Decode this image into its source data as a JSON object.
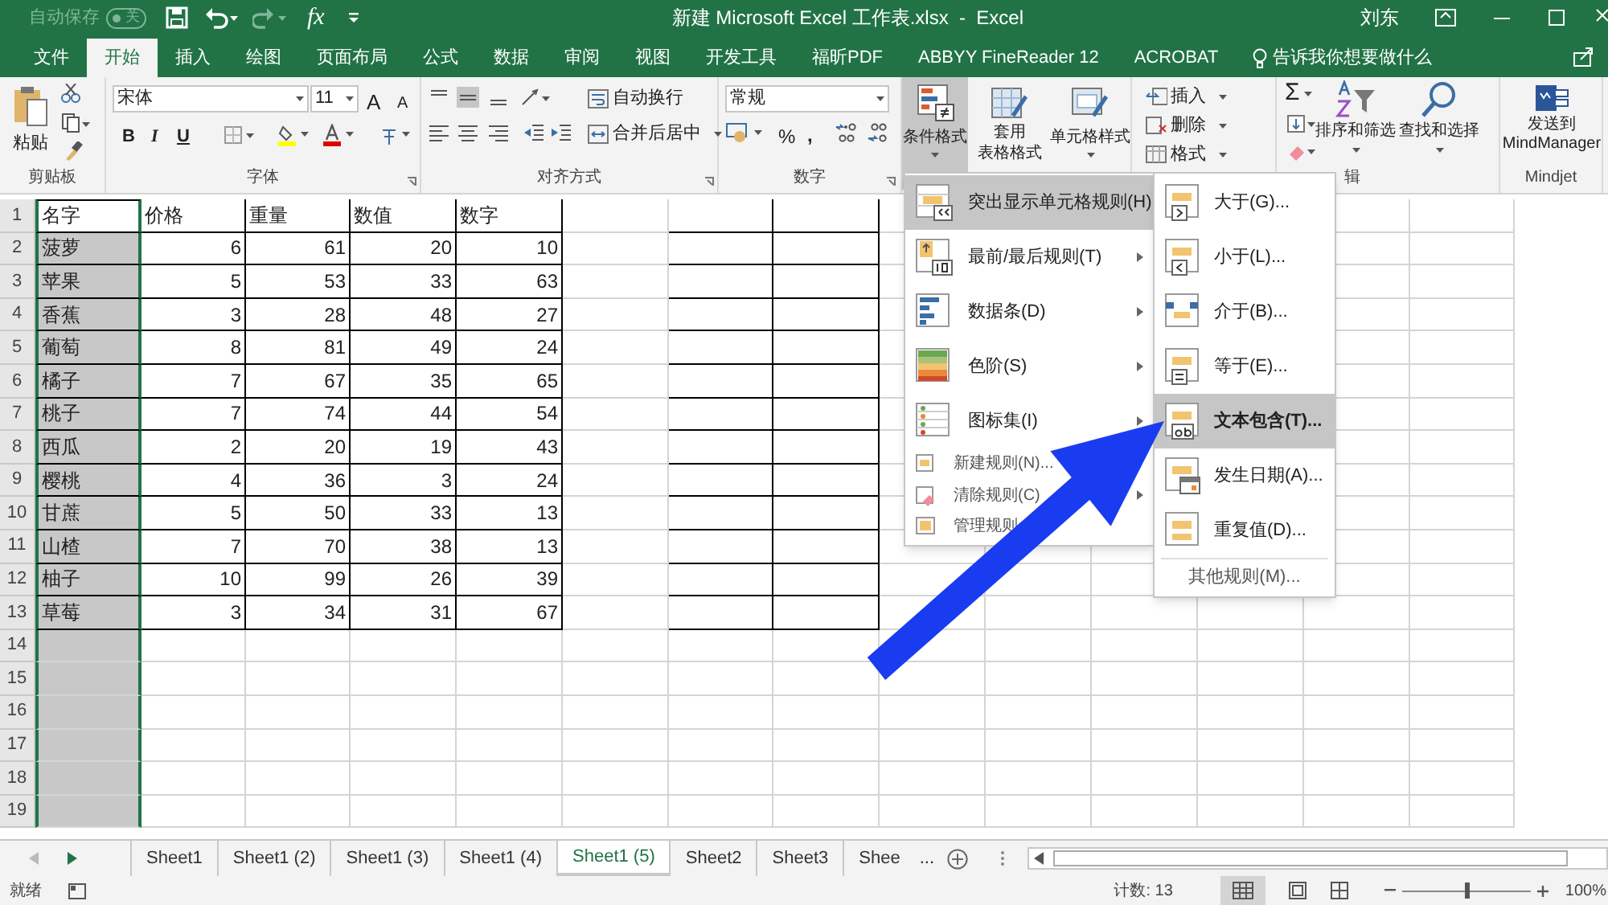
{
  "title_bar": {
    "autosave_label": "自动保存",
    "autosave_toggle": "关",
    "formula_glyph": "fx",
    "title": "新建 Microsoft Excel 工作表.xlsx  -  Excel",
    "user": "刘东"
  },
  "tabs": [
    {
      "label": "文件",
      "selected": false
    },
    {
      "label": "开始",
      "selected": true
    },
    {
      "label": "插入",
      "selected": false
    },
    {
      "label": "绘图",
      "selected": false
    },
    {
      "label": "页面布局",
      "selected": false
    },
    {
      "label": "公式",
      "selected": false
    },
    {
      "label": "数据",
      "selected": false
    },
    {
      "label": "审阅",
      "selected": false
    },
    {
      "label": "视图",
      "selected": false
    },
    {
      "label": "开发工具",
      "selected": false
    },
    {
      "label": "福昕PDF",
      "selected": false
    },
    {
      "label": "ABBYY FineReader 12",
      "selected": false
    },
    {
      "label": "ACROBAT",
      "selected": false
    }
  ],
  "tell_me": "告诉我你想要做什么",
  "ribbon": {
    "clipboard": {
      "paste": "粘贴",
      "label": "剪贴板"
    },
    "font": {
      "font_name": "宋体",
      "font_size": "11",
      "grow": "A",
      "shrink": "A",
      "bold": "B",
      "italic": "I",
      "underline": "U",
      "label": "字体"
    },
    "alignment": {
      "wrap": "自动换行",
      "merge": "合并后居中",
      "label": "对齐方式"
    },
    "number": {
      "format": "常规",
      "percent": "%",
      "comma": ",",
      "label": "数字"
    },
    "styles": {
      "conditional": "条件格式",
      "table_format": "套用",
      "table_format_2": "表格格式",
      "cell_styles": "单元格样式"
    },
    "cells": {
      "insert": "插入",
      "delete": "删除",
      "format": "格式"
    },
    "editing": {
      "sum": "Σ",
      "sort": "排序和筛选",
      "find": "查找和选择",
      "label": "辑"
    },
    "mindjet": {
      "send": "发送到",
      "send_2": "MindManager",
      "label": "Mindjet"
    }
  },
  "sheet": {
    "row_numbers": [
      "1",
      "2",
      "3",
      "4",
      "5",
      "6",
      "7",
      "8",
      "9",
      "10",
      "11",
      "12",
      "13",
      "14",
      "15",
      "16",
      "17",
      "18",
      "19"
    ],
    "rows": [
      [
        "名字",
        "价格",
        "重量",
        "数值",
        "数字"
      ],
      [
        "菠萝",
        "6",
        "61",
        "20",
        "10"
      ],
      [
        "苹果",
        "5",
        "53",
        "33",
        "63"
      ],
      [
        "香蕉",
        "3",
        "28",
        "48",
        "27"
      ],
      [
        "葡萄",
        "8",
        "81",
        "49",
        "24"
      ],
      [
        "橘子",
        "7",
        "67",
        "35",
        "65"
      ],
      [
        "桃子",
        "7",
        "74",
        "44",
        "54"
      ],
      [
        "西瓜",
        "2",
        "20",
        "19",
        "43"
      ],
      [
        "樱桃",
        "4",
        "36",
        "3",
        "24"
      ],
      [
        "甘蔗",
        "5",
        "50",
        "33",
        "13"
      ],
      [
        "山楂",
        "7",
        "70",
        "38",
        "13"
      ],
      [
        "柚子",
        "10",
        "99",
        "26",
        "39"
      ],
      [
        "草莓",
        "3",
        "34",
        "31",
        "67"
      ]
    ]
  },
  "conditional_menu": [
    {
      "kind": "big",
      "label": "突出显示单元格规则(H)",
      "selected": true,
      "submenu": true
    },
    {
      "kind": "big",
      "label": "最前/最后规则(T)",
      "selected": false,
      "submenu": true
    },
    {
      "kind": "big",
      "label": "数据条(D)",
      "selected": false,
      "submenu": true
    },
    {
      "kind": "big",
      "label": "色阶(S)",
      "selected": false,
      "submenu": true
    },
    {
      "kind": "big",
      "label": "图标集(I)",
      "selected": false,
      "submenu": true
    },
    {
      "kind": "small",
      "label": "新建规则(N)...",
      "selected": false,
      "submenu": false
    },
    {
      "kind": "small",
      "label": "清除规则(C)",
      "selected": false,
      "submenu": true
    },
    {
      "kind": "small",
      "label": "管理规则",
      "selected": false,
      "submenu": false
    }
  ],
  "highlight_submenu": {
    "items": [
      {
        "label": "大于(G)...",
        "selected": false
      },
      {
        "label": "小于(L)...",
        "selected": false
      },
      {
        "label": "介于(B)...",
        "selected": false
      },
      {
        "label": "等于(E)...",
        "selected": false
      },
      {
        "label": "文本包含(T)...",
        "selected": true
      },
      {
        "label": "发生日期(A)...",
        "selected": false
      },
      {
        "label": "重复值(D)...",
        "selected": false
      }
    ],
    "more": "其他规则(M)..."
  },
  "sheet_tabs": [
    {
      "label": "Sheet1",
      "selected": false
    },
    {
      "label": "Sheet1 (2)",
      "selected": false
    },
    {
      "label": "Sheet1 (3)",
      "selected": false
    },
    {
      "label": "Sheet1 (4)",
      "selected": false
    },
    {
      "label": "Sheet1 (5)",
      "selected": true
    },
    {
      "label": "Sheet2",
      "selected": false
    },
    {
      "label": "Sheet3",
      "selected": false
    },
    {
      "label": "Shee",
      "selected": false
    }
  ],
  "sheet_tabs_more": "...",
  "status_bar": {
    "mode": "就绪",
    "count": "计数: 13",
    "zoom": "100%",
    "zoom_slider": {
      "level": 0.5
    }
  }
}
